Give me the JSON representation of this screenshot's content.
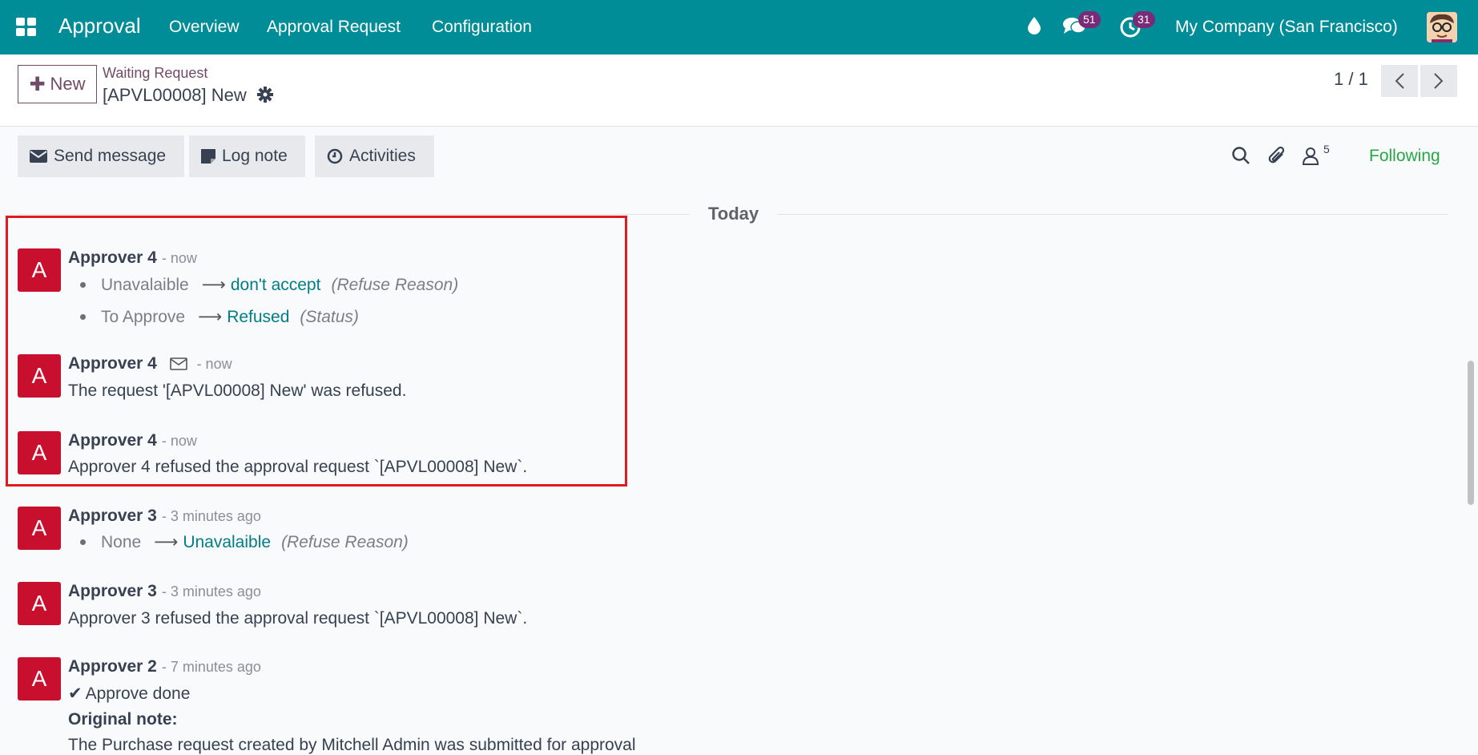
{
  "navbar": {
    "brand": "Approval",
    "items": [
      "Overview",
      "Approval Request",
      "Configuration"
    ],
    "messages_badge": "51",
    "activities_badge": "31",
    "company": "My Company (San Francisco)",
    "color": "#018d97"
  },
  "control": {
    "new_label": "New",
    "breadcrumb": "Waiting Request",
    "record_title": "[APVL00008] New",
    "pager": "1 / 1"
  },
  "chatter": {
    "send_message": "Send message",
    "log_note": "Log note",
    "activities": "Activities",
    "followers_count": "5",
    "following": "Following",
    "date_separator": "Today"
  },
  "messages": [
    {
      "avatar": "A",
      "author": "Approver 4",
      "time": "- now",
      "tracking": [
        {
          "old": "Unavalaible",
          "new": "don't accept",
          "field": "(Refuse Reason)"
        },
        {
          "old": "To Approve",
          "new": "Refused",
          "field": "(Status)"
        }
      ]
    },
    {
      "avatar": "A",
      "author": "Approver 4",
      "time": "- now",
      "body": "The request '[APVL00008] New' was refused."
    },
    {
      "avatar": "A",
      "author": "Approver 4",
      "time": "- now",
      "body": "Approver 4 refused the approval request `[APVL00008] New`."
    },
    {
      "avatar": "A",
      "author": "Approver 3",
      "time": "- 3 minutes ago",
      "tracking": [
        {
          "old": "None",
          "new": "Unavalaible",
          "field": "(Refuse Reason)"
        }
      ]
    },
    {
      "avatar": "A",
      "author": "Approver 3",
      "time": "- 3 minutes ago",
      "body": "Approver 3 refused the approval request `[APVL00008] New`."
    },
    {
      "avatar": "A",
      "author": "Approver 2",
      "time": "- 7 minutes ago",
      "body": "Approve done",
      "note_label": "Original note:",
      "note_text": "The Purchase request created by Mitchell Admin was submitted for approval"
    }
  ]
}
